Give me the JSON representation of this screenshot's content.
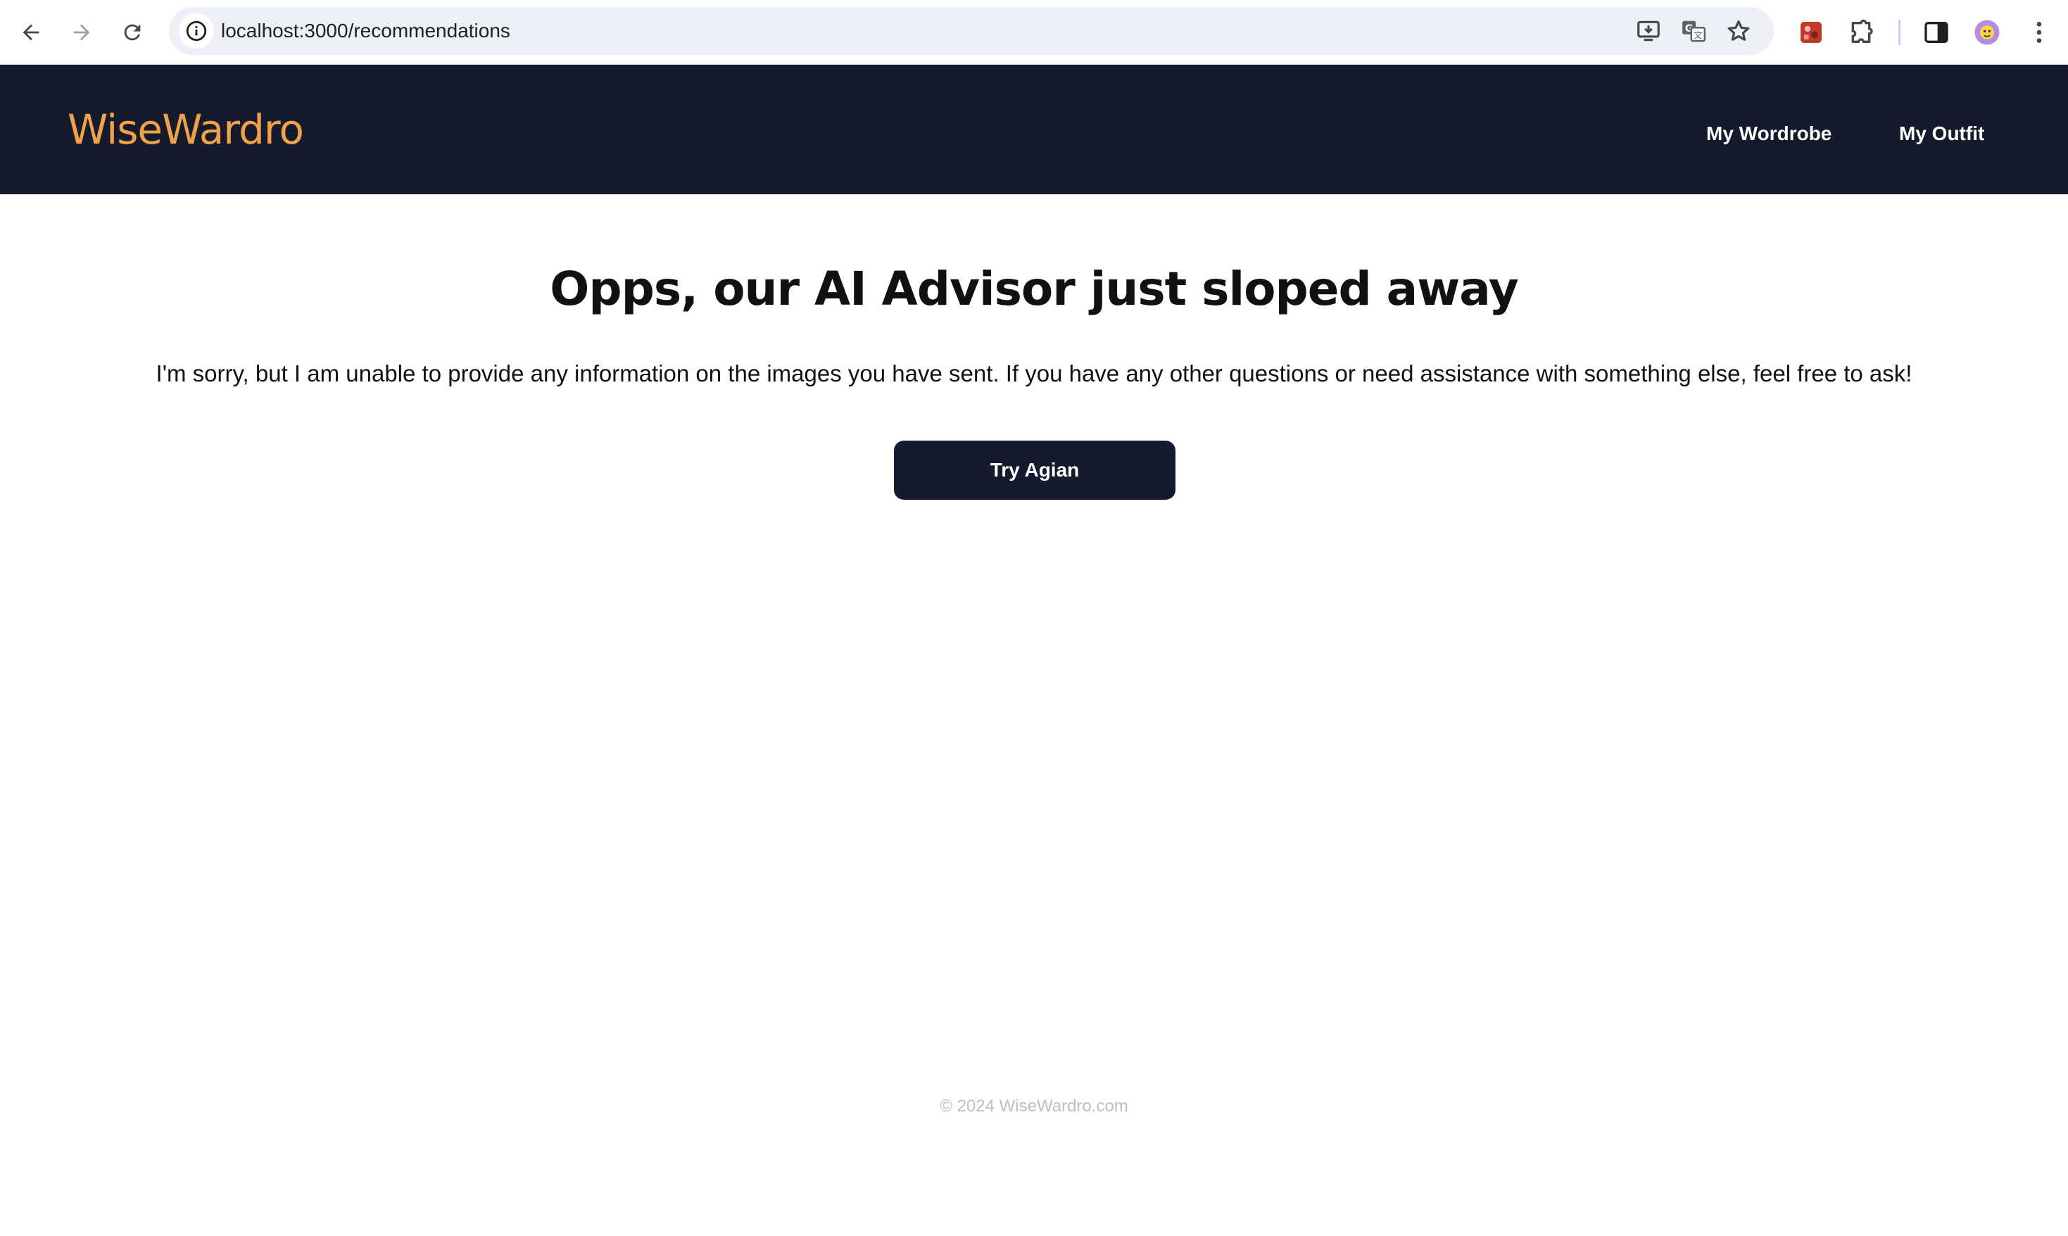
{
  "browser": {
    "url": "localhost:3000/recommendations",
    "icons": [
      "back-arrow-icon",
      "forward-arrow-icon",
      "reload-icon",
      "site-info-icon",
      "install-app-icon",
      "translate-icon",
      "bookmark-star-icon",
      "extension-app-icon",
      "extensions-puzzle-icon",
      "side-panel-icon",
      "profile-avatar",
      "more-menu-icon"
    ]
  },
  "header": {
    "brand": "WiseWardro",
    "nav": {
      "wardrobe": "My Wordrobe",
      "outfit": "My Outfit"
    }
  },
  "main": {
    "title": "Opps, our AI Advisor just sloped away",
    "message": "I'm sorry, but I am unable to provide any information on the images you have sent. If you have any other questions or need assistance with something else, feel free to ask!",
    "button": "Try Agian"
  },
  "footer": {
    "copyright": "© 2024 WiseWardro.com"
  },
  "colors": {
    "header_bg": "#151a2d",
    "brand": "#f0a24a",
    "button_bg": "#151a2d",
    "footer_text": "#b8bfd0"
  }
}
